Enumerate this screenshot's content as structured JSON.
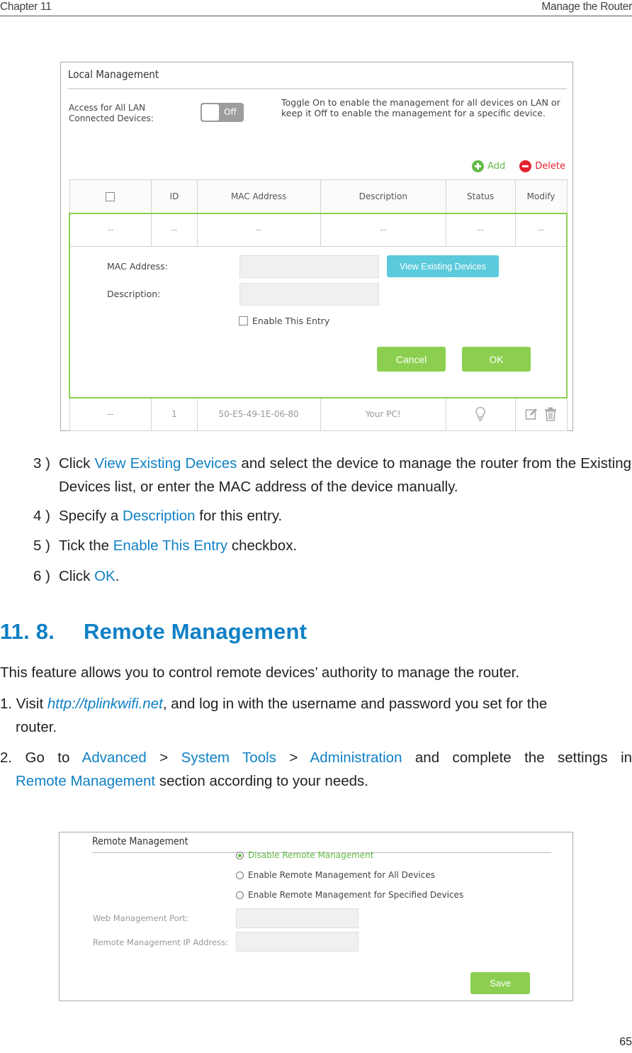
{
  "header": {
    "chapter": "Chapter 11",
    "section": "Manage the Router"
  },
  "local_management": {
    "title": "Local Management",
    "access_label": "Access for All LAN Connected Devices:",
    "toggle_state": "Off",
    "toggle_help": "Toggle On to enable the management for all devices on LAN or keep it Off to enable the management for a specific device.",
    "add_label": "Add",
    "delete_label": "Delete",
    "columns": [
      "ID",
      "MAC Address",
      "Description",
      "Status",
      "Modify"
    ],
    "placeholder_row": [
      "--",
      "--",
      "--",
      "--",
      "--",
      "--"
    ],
    "form": {
      "mac_label": "MAC Address:",
      "mac_value": "",
      "description_label": "Description:",
      "description_value": "",
      "view_devices_label": "View Existing Devices",
      "enable_label": "Enable This Entry",
      "enable_checked": false,
      "cancel_label": "Cancel",
      "ok_label": "OK"
    },
    "rows": [
      {
        "select": "--",
        "id": "1",
        "mac": "50-E5-49-1E-06-80",
        "description": "Your PC!",
        "status_icon": "bulb-icon"
      }
    ]
  },
  "steps": [
    {
      "num": "3 )",
      "parts": [
        "Click ",
        "View Existing Devices",
        " and select the device to manage the router from the Existing Devices list, or enter the MAC address of the device manually."
      ]
    },
    {
      "num": "4 )",
      "parts": [
        "Specify a ",
        "Description",
        " for this entry."
      ]
    },
    {
      "num": "5 )",
      "parts": [
        "Tick the ",
        "Enable This Entry",
        " checkbox."
      ]
    },
    {
      "num": "6 )",
      "parts": [
        "Click ",
        "OK",
        "."
      ]
    }
  ],
  "section": {
    "number": "11. 8.",
    "title": "Remote Management",
    "intro": "This feature allows you to control remote devices’ authority to manage the router.",
    "item1": {
      "prefix": "1. Visit ",
      "link": "http://tplinkwifi.net",
      "rest_line1": ", and log in with the username and password you set for the",
      "rest_line2": "router."
    },
    "item2": {
      "prefix": "2. Go to ",
      "nav1": "Advanced",
      "sep": ">",
      "nav2": "System Tools",
      "nav3": "Administration",
      "rest_line1": "and complete the settings in",
      "nav4": "Remote Management",
      "rest_line2": " section according to your needs."
    }
  },
  "remote_management": {
    "title": "Remote Management",
    "options": [
      {
        "label": "Disable Remote Management",
        "selected": true
      },
      {
        "label": "Enable Remote Management for All Devices",
        "selected": false
      },
      {
        "label": "Enable Remote Management for Specified Devices",
        "selected": false
      }
    ],
    "port_label": "Web Management Port:",
    "port_value": "",
    "ip_label": "Remote Management IP Address:",
    "ip_value": "",
    "save_label": "Save"
  },
  "colors": {
    "accent_blue": "#0f80c5",
    "green": "#8ccf50",
    "add_green": "#62bb46",
    "delete_red": "#e3212d",
    "view_btn": "#5bcadc"
  },
  "page_number": "65"
}
